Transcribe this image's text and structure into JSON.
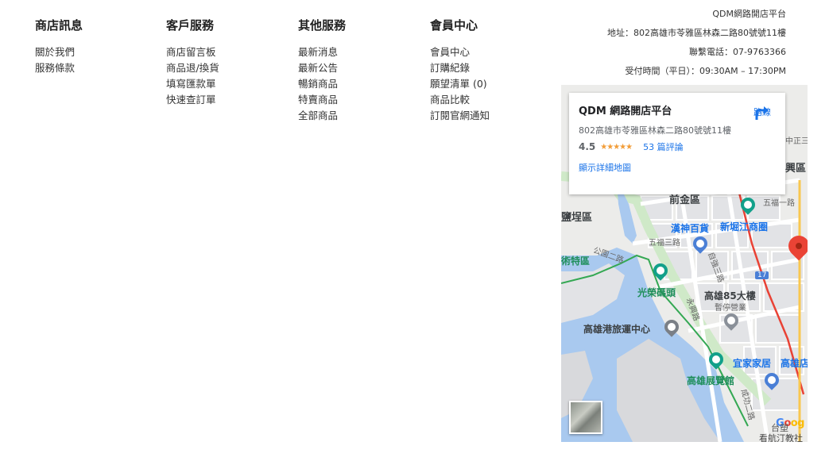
{
  "columns": [
    {
      "title": "商店訊息",
      "items": [
        "關於我們",
        "服務條款"
      ]
    },
    {
      "title": "客戶服務",
      "items": [
        "商店留言板",
        "商品退/換貨",
        "填寫匯款單",
        "快速查訂單"
      ]
    },
    {
      "title": "其他服務",
      "items": [
        "最新消息",
        "最新公告",
        "暢銷商品",
        "特賣商品",
        "全部商品"
      ]
    },
    {
      "title": "會員中心",
      "items": [
        "會員中心",
        "訂購紀錄",
        "願望清單 (0)",
        "商品比較",
        "訂閱官網通知"
      ]
    }
  ],
  "store_info": {
    "name": "QDM網路開店平台",
    "address": "地址：802高雄市苓雅區林森二路80號號11樓",
    "phone": "聯繫電話：07-9763366",
    "hours": "受付時間（平日）：09:30AM – 17:30PM"
  },
  "map": {
    "card": {
      "name": "QDM 網路開店平台",
      "address": "802高雄市苓雅區林森二路80號號11樓",
      "rating": "4.5",
      "stars": "★★★★★",
      "reviews": "53 篇評論",
      "detail_link": "顯示詳細地圖",
      "directions_label": "路線"
    },
    "labels": {
      "yanchengqu": "鹽埕區",
      "qianjinqu": "前金區",
      "xinxingqu": "興區",
      "hanshin": "漢神百貨",
      "xinjuejiang": "新堀江商圈",
      "guangrong": "光榮碼頭",
      "k85": "高雄85大樓",
      "k85_sub": "暫停營業",
      "cruise": "高雄港旅運中心",
      "ikea": "宜家家居",
      "kaohsiung_g": "高雄店",
      "exhibition": "高雄展覽館",
      "art_zone": "術特區",
      "road_wufu": "五福三路",
      "road_wufu4": "五福一路",
      "road_gongyuan": "公園二路",
      "road_zhongzheng": "中正三",
      "road_ziqiang": "自強三路",
      "road_yongxing": "永興路",
      "road_chenggong": "成功二路",
      "route_17": "17",
      "copyright": "台塑",
      "footer_partial": "看航汀教社"
    },
    "brand": {
      "g1": "G",
      "g2": "o",
      "g3": "og"
    }
  }
}
